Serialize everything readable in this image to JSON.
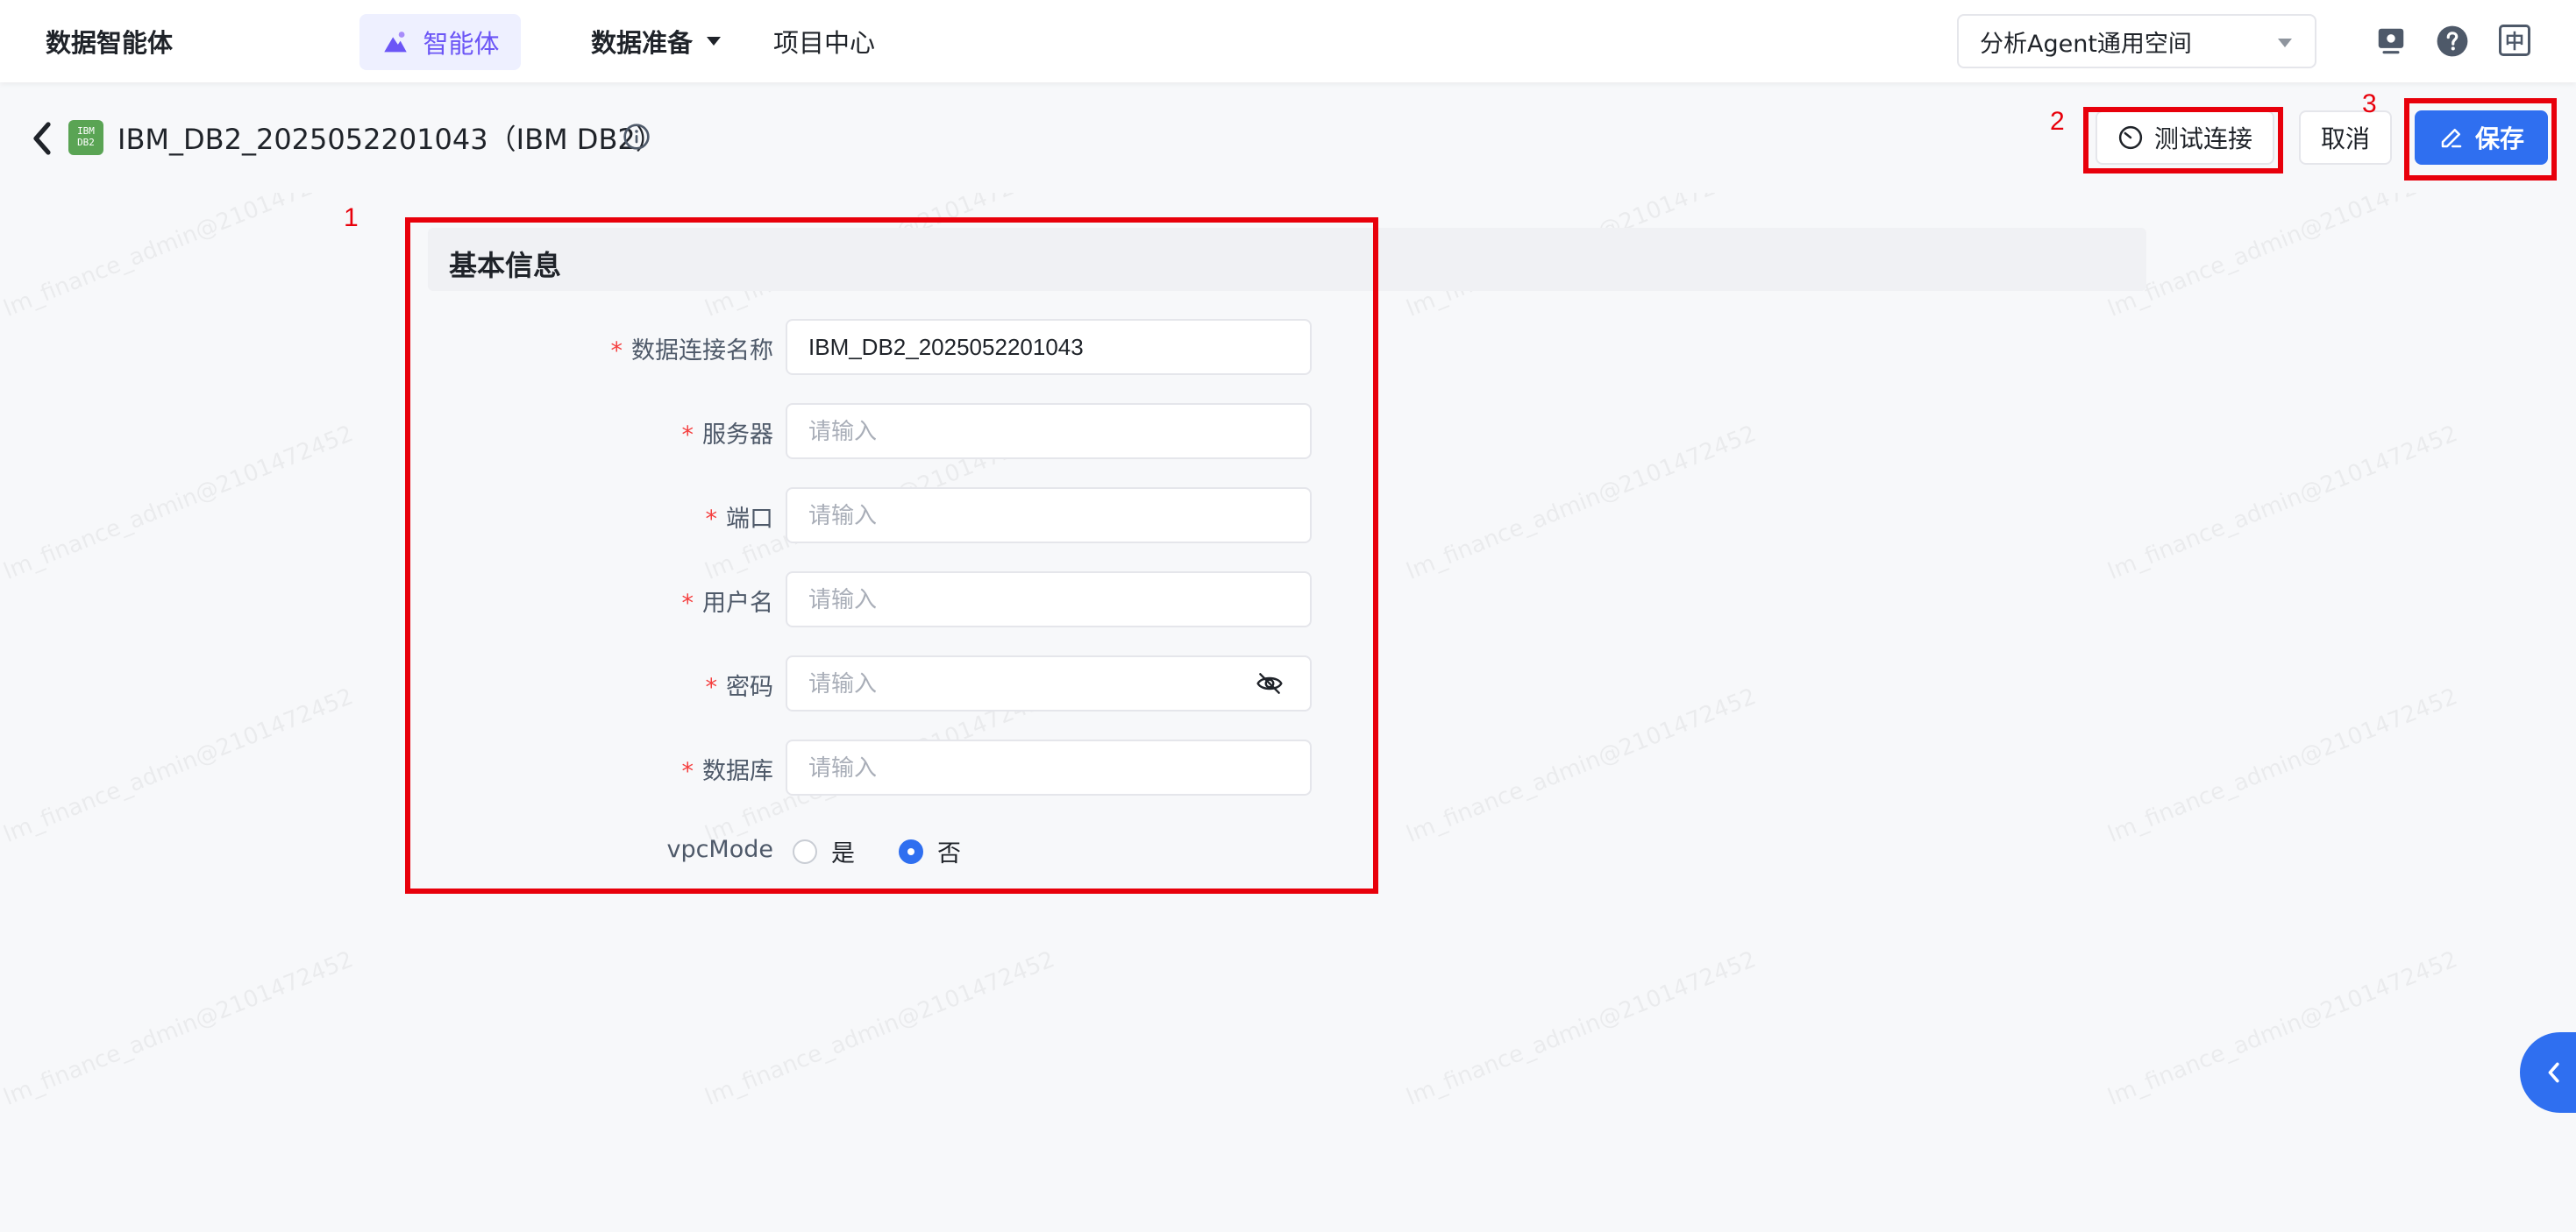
{
  "topnav": {
    "app_title": "数据智能体",
    "agent_tab": "智能体",
    "data_prep": "数据准备",
    "project_center": "项目中心",
    "workspace": "分析Agent通用空间",
    "lang": "中"
  },
  "header": {
    "db_logo_line1": "IBM",
    "db_logo_line2": "DB2",
    "title": "IBM_DB2_2025052201043（IBM DB2）",
    "test_connection": "测试连接",
    "cancel": "取消",
    "save": "保存"
  },
  "annotations": [
    "1",
    "2",
    "3"
  ],
  "form": {
    "section_title": "基本信息",
    "required_mark": "*",
    "fields": [
      {
        "label": "数据连接名称",
        "value": "IBM_DB2_2025052201043",
        "placeholder": "请输入"
      },
      {
        "label": "服务器",
        "value": "",
        "placeholder": "请输入"
      },
      {
        "label": "端口",
        "value": "",
        "placeholder": "请输入"
      },
      {
        "label": "用户名",
        "value": "",
        "placeholder": "请输入"
      },
      {
        "label": "密码",
        "value": "",
        "placeholder": "请输入"
      },
      {
        "label": "数据库",
        "value": "",
        "placeholder": "请输入"
      }
    ],
    "vpc_label": "vpcMode",
    "vpc_options": [
      "是",
      "否"
    ],
    "vpc_selected": "否"
  },
  "watermark": "lm_finance_admin@2101472452",
  "colors": {
    "primary": "#2f6ff0",
    "agent_accent": "#6b55f6",
    "annotation": "#e8000b",
    "required": "#f53f3f"
  },
  "icons": [
    "agent-icon",
    "back-icon",
    "info-icon",
    "timer-icon",
    "edit-icon",
    "eye-off-icon",
    "monitor-icon",
    "help-icon",
    "language-icon",
    "collapse-icon"
  ]
}
